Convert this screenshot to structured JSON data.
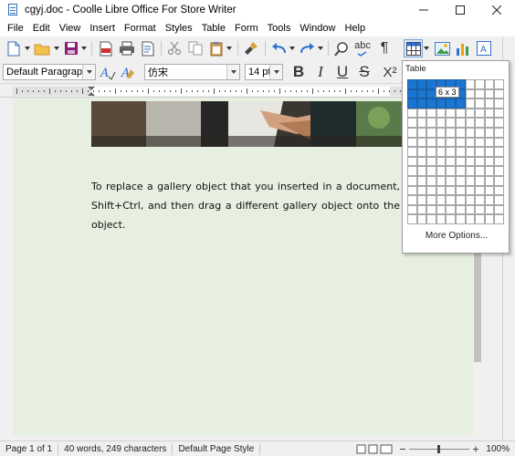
{
  "window": {
    "title": "cgyj.doc - Coolle Libre Office For Store Writer"
  },
  "menu": [
    "File",
    "Edit",
    "View",
    "Insert",
    "Format",
    "Styles",
    "Table",
    "Form",
    "Tools",
    "Window",
    "Help"
  ],
  "format_bar": {
    "paragraph_style": "Default Paragraph Style",
    "font_name": "仿宋",
    "font_size": "14 pt",
    "bold_label": "B",
    "italic_label": "I",
    "underline_label": "U",
    "strike_label": "S",
    "superscript_label": "X²"
  },
  "toolbar": {
    "spelling_label": "abc",
    "formatting_marks_label": "¶"
  },
  "document": {
    "paragraph": "To replace a gallery object that you inserted in a document, Shift+Ctrl, and then drag a different gallery object onto the object."
  },
  "table_popup": {
    "title": "Table",
    "size_tip": "6 x 3",
    "selected_cols": 6,
    "selected_rows": 3,
    "grid_cols": 10,
    "grid_rows": 15,
    "more_options": "More Options..."
  },
  "status": {
    "page": "Page 1 of 1",
    "words": "40 words, 249 characters",
    "page_style": "Default Page Style",
    "zoom": "100%"
  },
  "colors": {
    "page_background": "#e6efe0",
    "selection": "#1a76d2",
    "chrome": "#f0f0f0"
  }
}
